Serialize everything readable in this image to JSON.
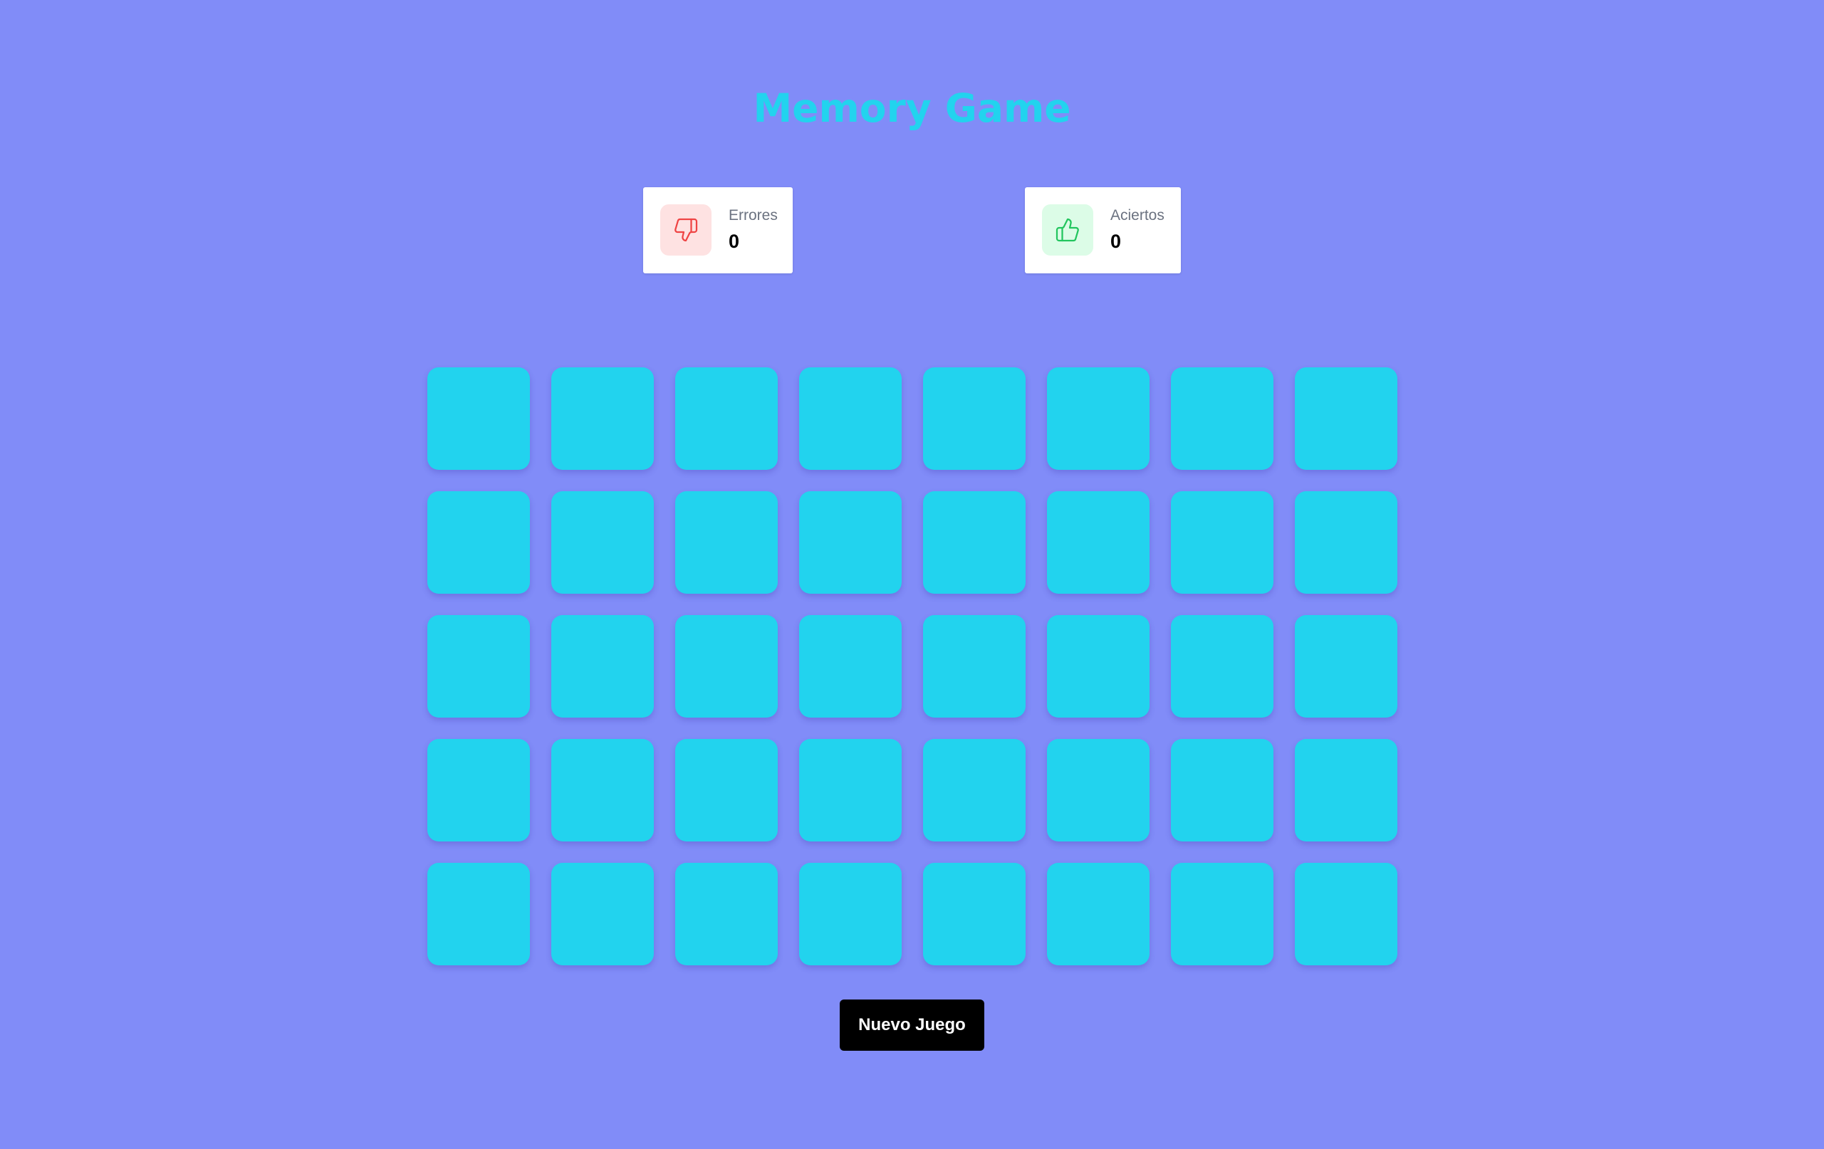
{
  "title": "Memory Game",
  "colors": {
    "background": "#818cf8",
    "title": "#22d3ee",
    "card_back": "#22d3ee",
    "errors_icon_bg": "#fee2e2",
    "errors_icon": "#ef4444",
    "hits_icon_bg": "#dcfce7",
    "hits_icon": "#22c55e",
    "button_bg": "#000000",
    "button_text": "#ffffff"
  },
  "stats": {
    "errors": {
      "label": "Errores",
      "value": "0",
      "icon": "thumbs-down-icon"
    },
    "hits": {
      "label": "Aciertos",
      "value": "0",
      "icon": "thumbs-up-icon"
    }
  },
  "board": {
    "rows": 5,
    "columns": 8,
    "cards_face_down": 40
  },
  "new_game_button": "Nuevo Juego"
}
